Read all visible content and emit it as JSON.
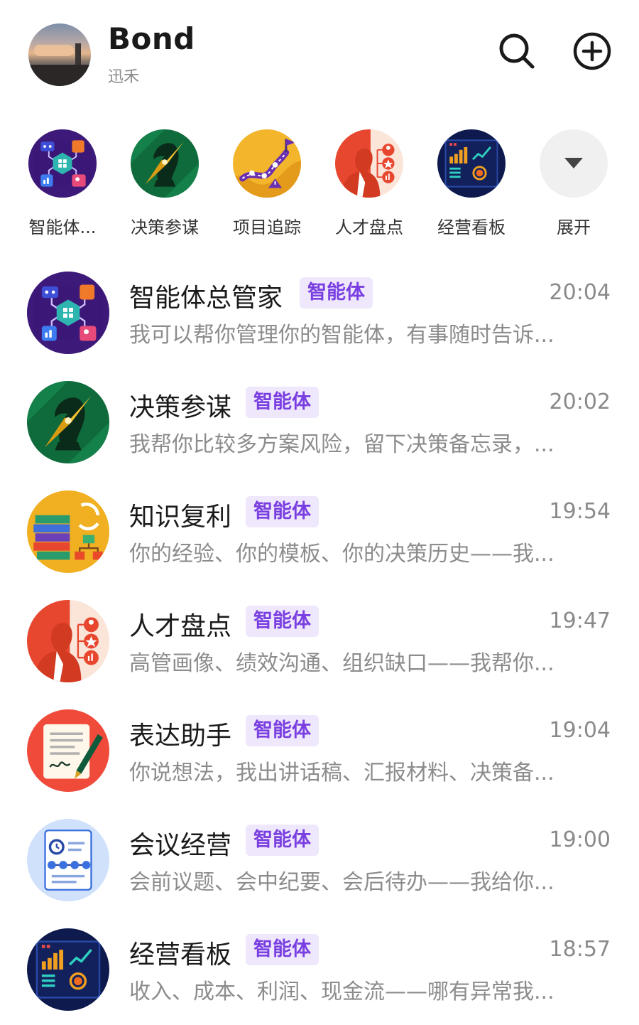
{
  "header": {
    "name": "Bond",
    "subtitle": "迅禾",
    "search_icon": "search-icon",
    "add_icon": "plus-circle-icon"
  },
  "quick_agents": [
    {
      "label": "智能体...",
      "icon": "agent-hub-icon"
    },
    {
      "label": "决策参谋",
      "icon": "chess-knight-compass-icon"
    },
    {
      "label": "项目追踪",
      "icon": "roadmap-flag-icon"
    },
    {
      "label": "人才盘点",
      "icon": "talent-profile-icon"
    },
    {
      "label": "经营看板",
      "icon": "business-dashboard-icon"
    },
    {
      "label": "展开",
      "icon": "chevron-down-icon"
    }
  ],
  "badge_label": "智能体",
  "chats": [
    {
      "title": "智能体总管家",
      "time": "20:04",
      "message": "我可以帮你管理你的智能体，有事随时告诉...",
      "icon": "agent-hub-icon"
    },
    {
      "title": "决策参谋",
      "time": "20:02",
      "message": "我帮你比较多方案风险，留下决策备忘录，...",
      "icon": "chess-knight-compass-icon"
    },
    {
      "title": "知识复利",
      "time": "19:54",
      "message": "你的经验、你的模板、你的决策历史——我...",
      "icon": "books-flowchart-icon"
    },
    {
      "title": "人才盘点",
      "time": "19:47",
      "message": "高管画像、绩效沟通、组织缺口——我帮你...",
      "icon": "talent-profile-icon"
    },
    {
      "title": "表达助手",
      "time": "19:04",
      "message": "你说想法，我出讲话稿、汇报材料、决策备...",
      "icon": "document-pen-icon"
    },
    {
      "title": "会议经营",
      "time": "19:00",
      "message": "会前议题、会中纪要、会后待办——我给你...",
      "icon": "meeting-checklist-icon"
    },
    {
      "title": "经营看板",
      "time": "18:57",
      "message": "收入、成本、利润、现金流——哪有异常我...",
      "icon": "business-dashboard-icon"
    }
  ],
  "colors": {
    "badge_text": "#7a3fe0",
    "badge_bg": "#efe8fd",
    "muted_text": "#8c8c8c"
  }
}
